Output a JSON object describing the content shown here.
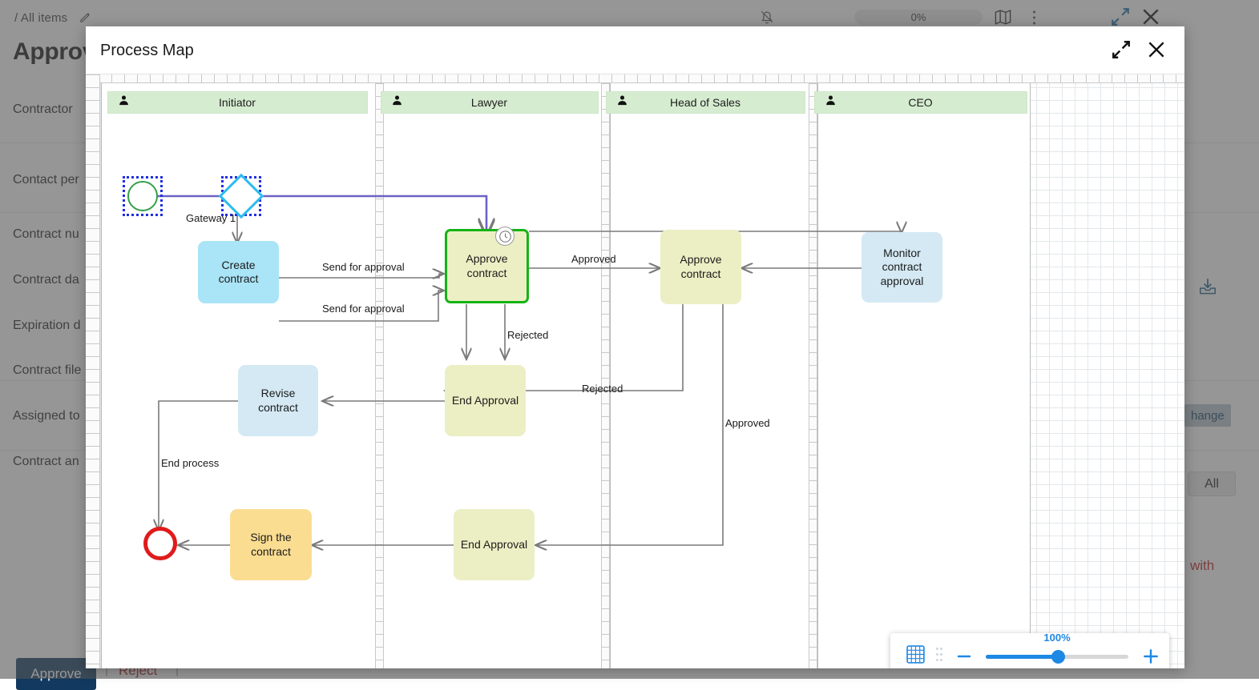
{
  "background": {
    "breadcrumb": "/ All items",
    "breadcrumb_edit_icon": "pencil-icon",
    "page_title": "Approv",
    "field_labels": [
      "Contractor",
      "Contact per",
      "Contract nu",
      "Contract da",
      "Expiration d",
      "Contract file",
      "Assigned to",
      "Contract an"
    ],
    "topbar": {
      "notifications_icon": "bell-off-icon",
      "progress_value": "0%",
      "map_icon": "map-icon",
      "more_icon": "kebab-menu-icon",
      "expand_icon": "expand-arrows-icon",
      "close_icon": "close-icon"
    },
    "download_icon": "download-icon",
    "change_chip": "hange",
    "all_chip": "All",
    "with_text": "with",
    "approve_button": "Approve",
    "reject_button": "Reject",
    "separator": "|"
  },
  "modal": {
    "title": "Process Map",
    "expand_icon": "expand-arrows-icon",
    "close_icon": "close-icon"
  },
  "zoom_control": {
    "grid_icon": "grid-icon",
    "drag_handle_icon": "drag-handle-icon",
    "minus_label": "−",
    "plus_label": "+",
    "value": "100%",
    "accent_color": "#1e88e5"
  },
  "diagram": {
    "lanes": [
      {
        "name": "Initiator",
        "actor_icon": "person-icon"
      },
      {
        "name": "Lawyer",
        "actor_icon": "person-icon"
      },
      {
        "name": "Head of Sales",
        "actor_icon": "person-icon"
      },
      {
        "name": "CEO",
        "actor_icon": "person-icon"
      }
    ],
    "nodes": [
      {
        "id": "start",
        "label": "",
        "type": "start-event",
        "color": "#ffffff"
      },
      {
        "id": "gateway1",
        "label": "Gateway 1",
        "type": "gateway",
        "color": "#2bbbf0"
      },
      {
        "id": "create",
        "label": "Create contract",
        "type": "task",
        "color": "#a9e4f7"
      },
      {
        "id": "approve_lawyer",
        "label": "Approve contract",
        "type": "task-active",
        "color": "#ecefc4"
      },
      {
        "id": "approve_hos",
        "label": "Approve contract",
        "type": "task",
        "color": "#ecefc4"
      },
      {
        "id": "monitor",
        "label": "Monitor contract approval",
        "type": "task",
        "color": "#d4e9f4"
      },
      {
        "id": "revise",
        "label": "Revise contract",
        "type": "task",
        "color": "#d4e9f4"
      },
      {
        "id": "end_appr_1",
        "label": "End Approval",
        "type": "task",
        "color": "#ecefc4"
      },
      {
        "id": "end_appr_2",
        "label": "End Approval",
        "type": "task",
        "color": "#ecefc4"
      },
      {
        "id": "sign",
        "label": "Sign the contract",
        "type": "task",
        "color": "#fbdd91"
      },
      {
        "id": "end",
        "label": "",
        "type": "end-event",
        "color": "#e01b1b"
      }
    ],
    "edge_labels": [
      "Send for approval",
      "Send for approval",
      "Approved",
      "Rejected",
      "Rejected",
      "Approved",
      "End process"
    ],
    "badges": [
      {
        "on": "approve_lawyer",
        "icon": "timer-clock-icon"
      }
    ],
    "active_border_color": "#15b315",
    "selection_border_color": "#1f2fe0"
  }
}
